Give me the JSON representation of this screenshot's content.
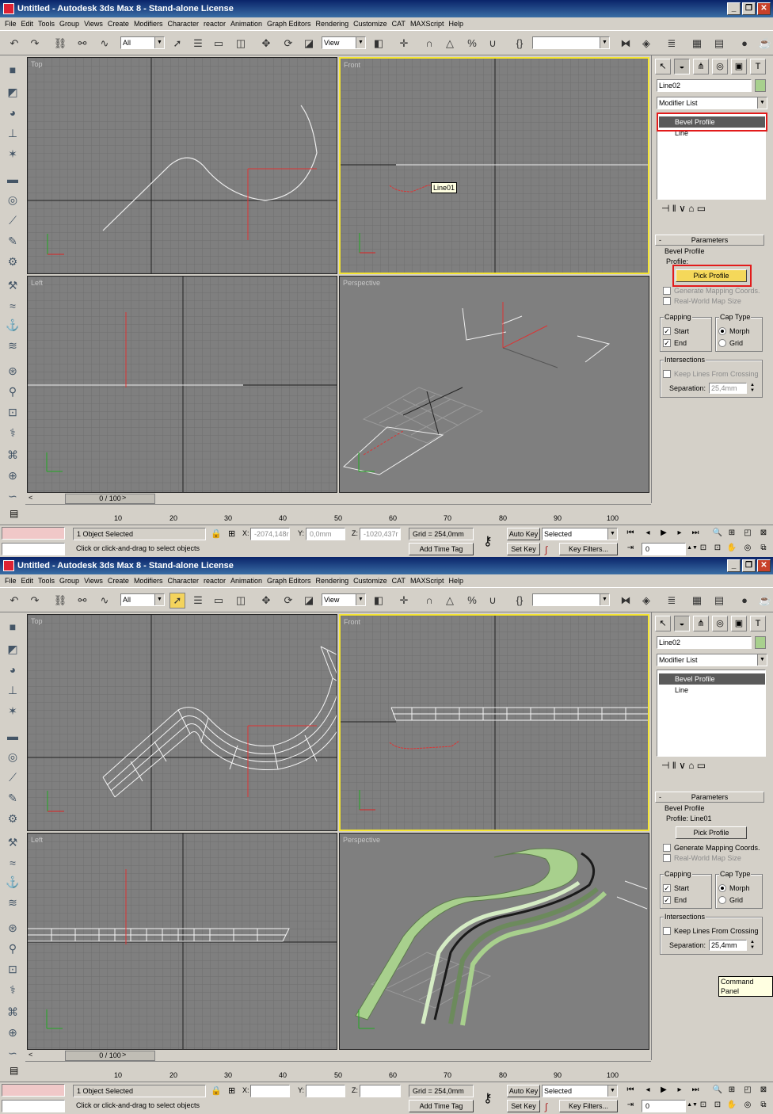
{
  "window": {
    "title": "Untitled   - Autodesk 3ds Max 8   - Stand-alone License",
    "minimize": "_",
    "restore": "❐",
    "close": "✕"
  },
  "menu": [
    "File",
    "Edit",
    "Tools",
    "Group",
    "Views",
    "Create",
    "Modifiers",
    "Character",
    "reactor",
    "Animation",
    "Graph Editors",
    "Rendering",
    "Customize",
    "CAT",
    "MAXScript",
    "Help"
  ],
  "toolbar": {
    "selection_filter": "All",
    "ref_coord": "View",
    "named_selection": ""
  },
  "viewports": {
    "top": "Top",
    "front": "Front",
    "left": "Left",
    "perspective": "Perspective",
    "object_tag": "Line01"
  },
  "command_panel": {
    "object_name": "Line02",
    "modifier_list": "Modifier List",
    "stack": [
      "Bevel Profile",
      "Line"
    ],
    "parameters_title": "Parameters",
    "bevel_profile_label": "Bevel Profile",
    "profile_label_before": "Profile:",
    "profile_label_after": "Profile: Line01",
    "pick_profile": "Pick Profile",
    "generate_mapping": "Generate Mapping Coords.",
    "real_world_map": "Real-World Map Size",
    "capping": "Capping",
    "start": "Start",
    "end": "End",
    "cap_type": "Cap Type",
    "morph": "Morph",
    "grid": "Grid",
    "intersections": "Intersections",
    "keep_lines": "Keep Lines From Crossing",
    "separation_label": "Separation:",
    "separation": "25,4mm"
  },
  "timeline": {
    "frame_display": "0 / 100",
    "ticks": [
      "10",
      "20",
      "30",
      "40",
      "50",
      "60",
      "70",
      "80",
      "90",
      "100"
    ]
  },
  "status": {
    "selected": "1 Object Selected",
    "prompt": "Click or click-and-drag to select objects",
    "x_label": "X:",
    "y_label": "Y:",
    "z_label": "Z:",
    "x_before": "-2074,148r",
    "y_before": "0,0mm",
    "z_before": "-1020,437r",
    "grid": "Grid = 254,0mm",
    "add_time_tag": "Add Time Tag",
    "auto_key": "Auto Key",
    "set_key": "Set Key",
    "key_mode": "Selected",
    "key_filters": "Key Filters...",
    "frame": "0"
  },
  "tooltip": "Command Panel",
  "colors": {
    "viewport_bg": "#7f7f7f",
    "active_border": "#f5e532",
    "highlight_box": "#e21b1b",
    "mesh_green": "#a8d08d"
  }
}
